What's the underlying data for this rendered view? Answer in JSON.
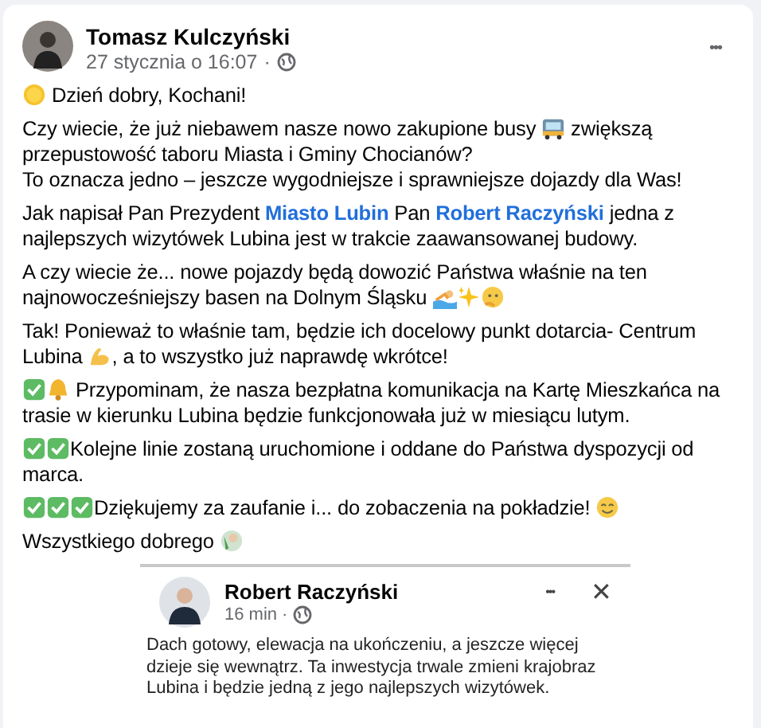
{
  "post": {
    "author": "Tomasz Kulczyński",
    "time": "27 stycznia o 16:07",
    "separator": "·",
    "more": "•••",
    "paragraphs": [
      {
        "lines": [
          [
            {
              "kind": "sun"
            },
            {
              "kind": "text",
              "text": " Dzień dobry, Kochani!"
            }
          ]
        ]
      },
      {
        "lines": [
          [
            {
              "kind": "text",
              "text": "Czy wiecie, że już niebawem nasze nowo zakupione busy "
            },
            {
              "kind": "bus"
            },
            {
              "kind": "text",
              "text": " zwiększą przepustowość taboru Miasta i Gminy Chocianów?"
            }
          ],
          [
            {
              "kind": "text",
              "text": "To oznacza jedno – jeszcze wygodniejsze i sprawniejsze dojazdy dla Was!"
            }
          ]
        ]
      },
      {
        "lines": [
          [
            {
              "kind": "text",
              "text": "Jak napisał Pan Prezydent "
            },
            {
              "kind": "link",
              "text": "Miasto Lubin"
            },
            {
              "kind": "text",
              "text": " Pan "
            },
            {
              "kind": "link",
              "text": "Robert Raczyński"
            },
            {
              "kind": "text",
              "text": " jedna z najlepszych wizytówek Lubina jest w trakcie zaawansowanej budowy."
            }
          ]
        ]
      },
      {
        "lines": [
          [
            {
              "kind": "text",
              "text": "A czy wiecie że... nowe pojazdy będą dowozić Państwa właśnie na ten najnowocześniejszy basen na Dolnym Śląsku "
            },
            {
              "kind": "pool"
            },
            {
              "kind": "sparkles"
            },
            {
              "kind": "thinking"
            }
          ]
        ]
      },
      {
        "lines": [
          [
            {
              "kind": "text",
              "text": "Tak! Ponieważ to właśnie tam, będzie ich docelowy punkt dotarcia- Centrum Lubina "
            },
            {
              "kind": "muscle"
            },
            {
              "kind": "text",
              "text": ", a to wszystko już naprawdę wkrótce!"
            }
          ]
        ]
      },
      {
        "lines": [
          [
            {
              "kind": "check"
            },
            {
              "kind": "bell"
            },
            {
              "kind": "text",
              "text": " Przypominam, że nasza bezpłatna komunikacja na Kartę Mieszkańca na trasie w kierunku Lubina będzie funkcjonowała już w miesiącu lutym."
            }
          ]
        ]
      },
      {
        "lines": [
          [
            {
              "kind": "check"
            },
            {
              "kind": "check"
            },
            {
              "kind": "text",
              "text": "Kolejne linie zostaną uruchomione i oddane do Państwa dyspozycji od marca."
            }
          ]
        ]
      },
      {
        "lines": [
          [
            {
              "kind": "check"
            },
            {
              "kind": "check"
            },
            {
              "kind": "check"
            },
            {
              "kind": "text",
              "text": "Dziękujemy za zaufanie i... do zobaczenia na pokładzie! "
            },
            {
              "kind": "smile"
            }
          ]
        ]
      },
      {
        "lines": [
          [
            {
              "kind": "text",
              "text": "Wszystkiego dobrego "
            },
            {
              "kind": "wave"
            }
          ]
        ]
      }
    ],
    "shared": {
      "author": "Robert Raczyński",
      "time": "16 min",
      "separator": "·",
      "more": "•••",
      "close": "✕",
      "text": "Dach gotowy, elewacja na ukończeniu, a jeszcze więcej dzieje się wewnątrz. Ta inwestycja trwale zmieni krajobraz Lubina i będzie jedną z jego najlepszych wizytówek."
    }
  }
}
